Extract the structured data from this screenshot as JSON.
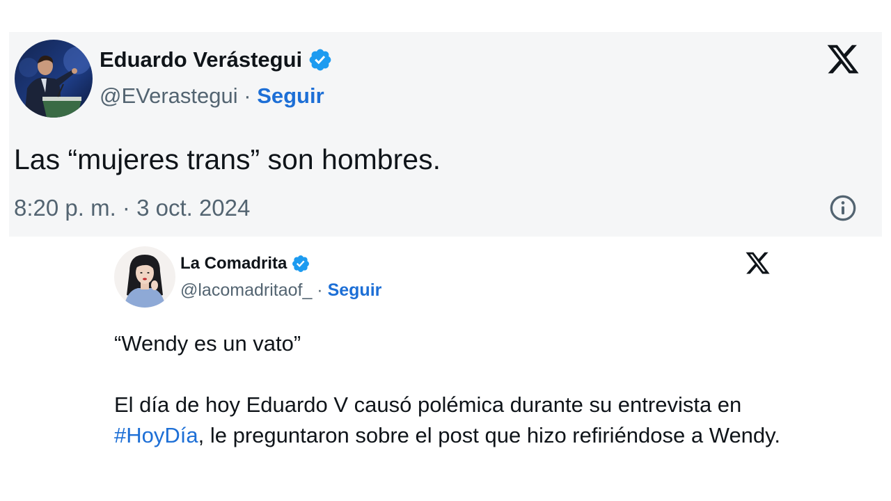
{
  "tweet1": {
    "author_name": "Eduardo Verástegui",
    "handle": "@EVerastegui",
    "separator": " · ",
    "follow_label": "Seguir",
    "text": "Las “mujeres trans” son hombres.",
    "timestamp": "8:20 p. m. · 3 oct. 2024",
    "verified": true,
    "avatar_icon": "profile-photo-speaker",
    "logo_icon": "x-logo-icon",
    "info_icon": "info-icon"
  },
  "tweet2": {
    "author_name": "La Comadrita",
    "handle": "@lacomadritaof_",
    "separator": " · ",
    "follow_label": "Seguir",
    "quote_line": "“Wendy es un vato”",
    "body_before_hashtag": "El día de hoy Eduardo V causó polémica durante su entrevista en ",
    "hashtag": "#HoyDía",
    "body_after_hashtag": ", le preguntaron sobre el post que hizo refiriéndose a Wendy.",
    "verified": true,
    "avatar_icon": "illustrated-woman-avatar",
    "logo_icon": "x-logo-icon"
  },
  "colors": {
    "link_blue": "#1d6fd6",
    "verified_blue": "#1d9bf0",
    "secondary_text": "#536471",
    "card_bg": "#f5f6f7"
  }
}
